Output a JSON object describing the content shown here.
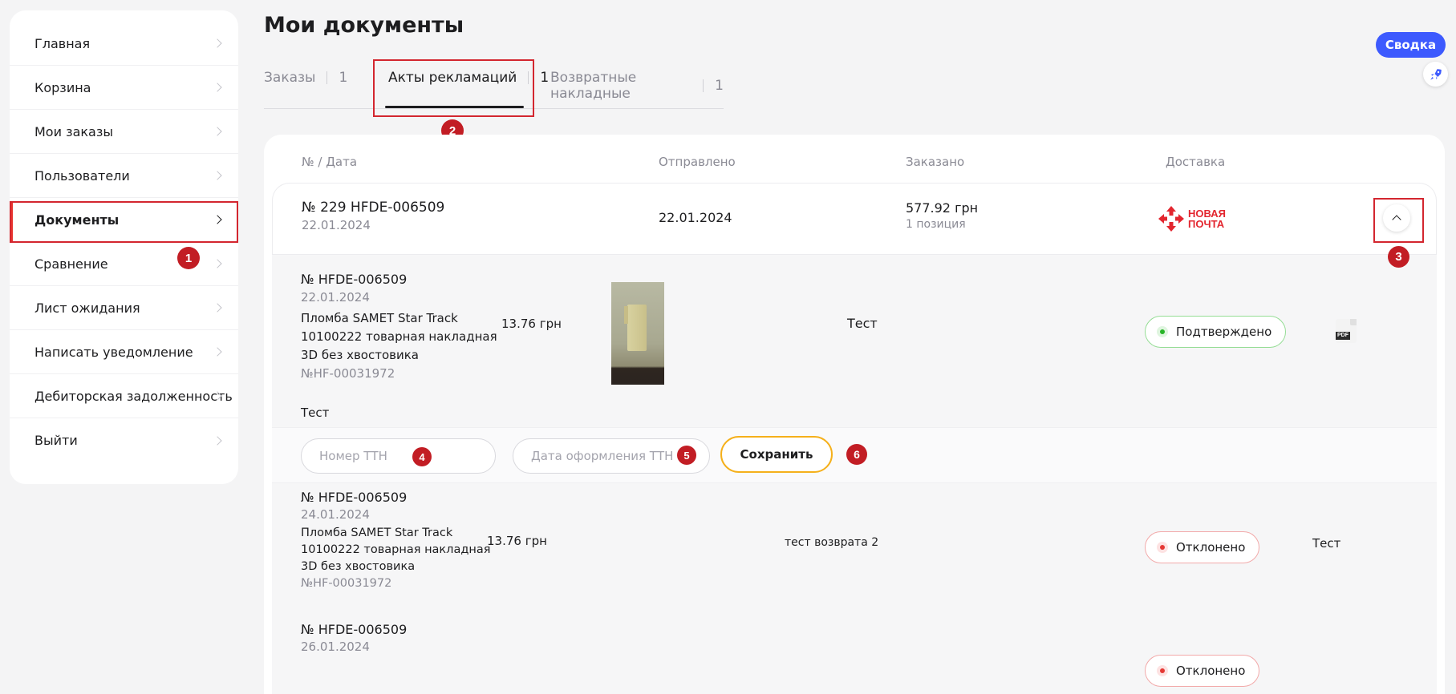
{
  "sidebar": {
    "items": [
      {
        "label": "Главная"
      },
      {
        "label": "Корзина"
      },
      {
        "label": "Мои заказы"
      },
      {
        "label": "Пользователи"
      },
      {
        "label": "Документы"
      },
      {
        "label": "Сравнение"
      },
      {
        "label": "Лист ожидания"
      },
      {
        "label": "Написать уведомление"
      },
      {
        "label": "Дебиторская задолженность"
      },
      {
        "label": "Выйти"
      }
    ]
  },
  "page": {
    "title": "Мои документы"
  },
  "tabs": [
    {
      "label": "Заказы",
      "count": "1"
    },
    {
      "label": "Акты рекламаций",
      "count": "1"
    },
    {
      "label": "Возвратные накладные",
      "count": "1"
    }
  ],
  "header": {
    "summary_button": "Сводка",
    "fab_icon": "rocket-icon"
  },
  "table": {
    "columns": [
      "№ / Дата",
      "Отправлено",
      "Заказано",
      "Доставка"
    ]
  },
  "order": {
    "number": "№ 229 HFDE-006509",
    "date": "22.01.2024",
    "sent": "22.01.2024",
    "amount": "577.92 грн",
    "positions": "1 позиция",
    "delivery_logo": [
      "НОВАЯ",
      "ПОЧТА"
    ],
    "delivery_color": "#e3262f"
  },
  "details": [
    {
      "number": "№ HFDE-006509",
      "date": "22.01.2024",
      "product": [
        "Пломба SAMET Star Track",
        "10100222 товарная накладная",
        "3D без хвостовика"
      ],
      "code": "№HF-00031972",
      "price": "13.76 грн",
      "comment": "Тест",
      "status": "Подтверждено",
      "file_icon": "pdf-icon",
      "file_label": "PDF",
      "note": "Тест"
    },
    {
      "number": "№ HFDE-006509",
      "date": "24.01.2024",
      "product": [
        "Пломба SAMET Star Track",
        "10100222 товарная накладная",
        "3D без хвостовика"
      ],
      "code": "№HF-00031972",
      "price": "13.76 грн",
      "comment": "тест возврата 2",
      "status": "Отклонено",
      "extra": "Тест"
    },
    {
      "number": "№ HFDE-006509",
      "date": "26.01.2024",
      "status": "Отклонено"
    }
  ],
  "ttn_form": {
    "number_placeholder": "Номер ТТН",
    "date_placeholder": "Дата оформления ТТН",
    "save_label": "Сохранить"
  },
  "markers": [
    "1",
    "2",
    "3",
    "4",
    "5",
    "6"
  ],
  "colors": {
    "accent": "#3d5afe",
    "highlight": "#d3262f",
    "save_border": "#f5b01b"
  }
}
